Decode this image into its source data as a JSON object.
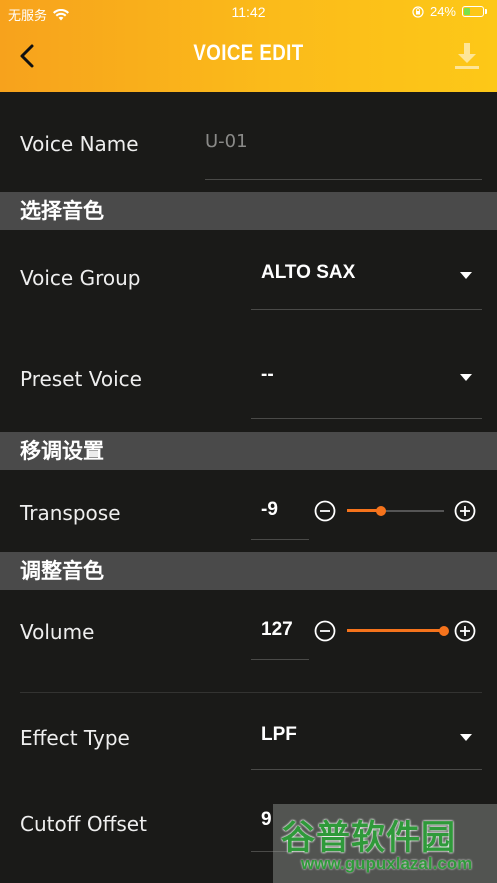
{
  "status_bar": {
    "carrier": "无服务",
    "time": "11:42",
    "battery_percent": "24%",
    "icons": [
      "wifi-icon",
      "orientation-lock-icon",
      "battery-icon"
    ]
  },
  "header": {
    "title": "VOICE EDIT",
    "back_icon": "chevron-left-icon",
    "download_icon": "download-icon",
    "gradient": [
      "#f7a21c",
      "#fdc817"
    ]
  },
  "fields": {
    "voice_name": {
      "label": "Voice Name",
      "value": "U-01"
    },
    "voice_group": {
      "label": "Voice Group",
      "value": "ALTO SAX"
    },
    "preset_voice": {
      "label": "Preset Voice",
      "value": "--"
    },
    "transpose": {
      "label": "Transpose",
      "value": "-9",
      "slider_fraction": 0.35
    },
    "volume": {
      "label": "Volume",
      "value": "127",
      "slider_fraction": 1.0
    },
    "effect_type": {
      "label": "Effect Type",
      "value": "LPF"
    },
    "cutoff_offset": {
      "label": "Cutoff Offset",
      "value": "9"
    }
  },
  "sections": {
    "select_voice": "选择音色",
    "transpose_settings": "移调设置",
    "adjust_voice": "调整音色"
  },
  "watermark": {
    "text": "谷普软件园",
    "url": "www.gupuxlazal.com"
  },
  "colors": {
    "accent": "#f5731c",
    "background": "#1a1a18",
    "section_bg": "#4a4a4a"
  }
}
